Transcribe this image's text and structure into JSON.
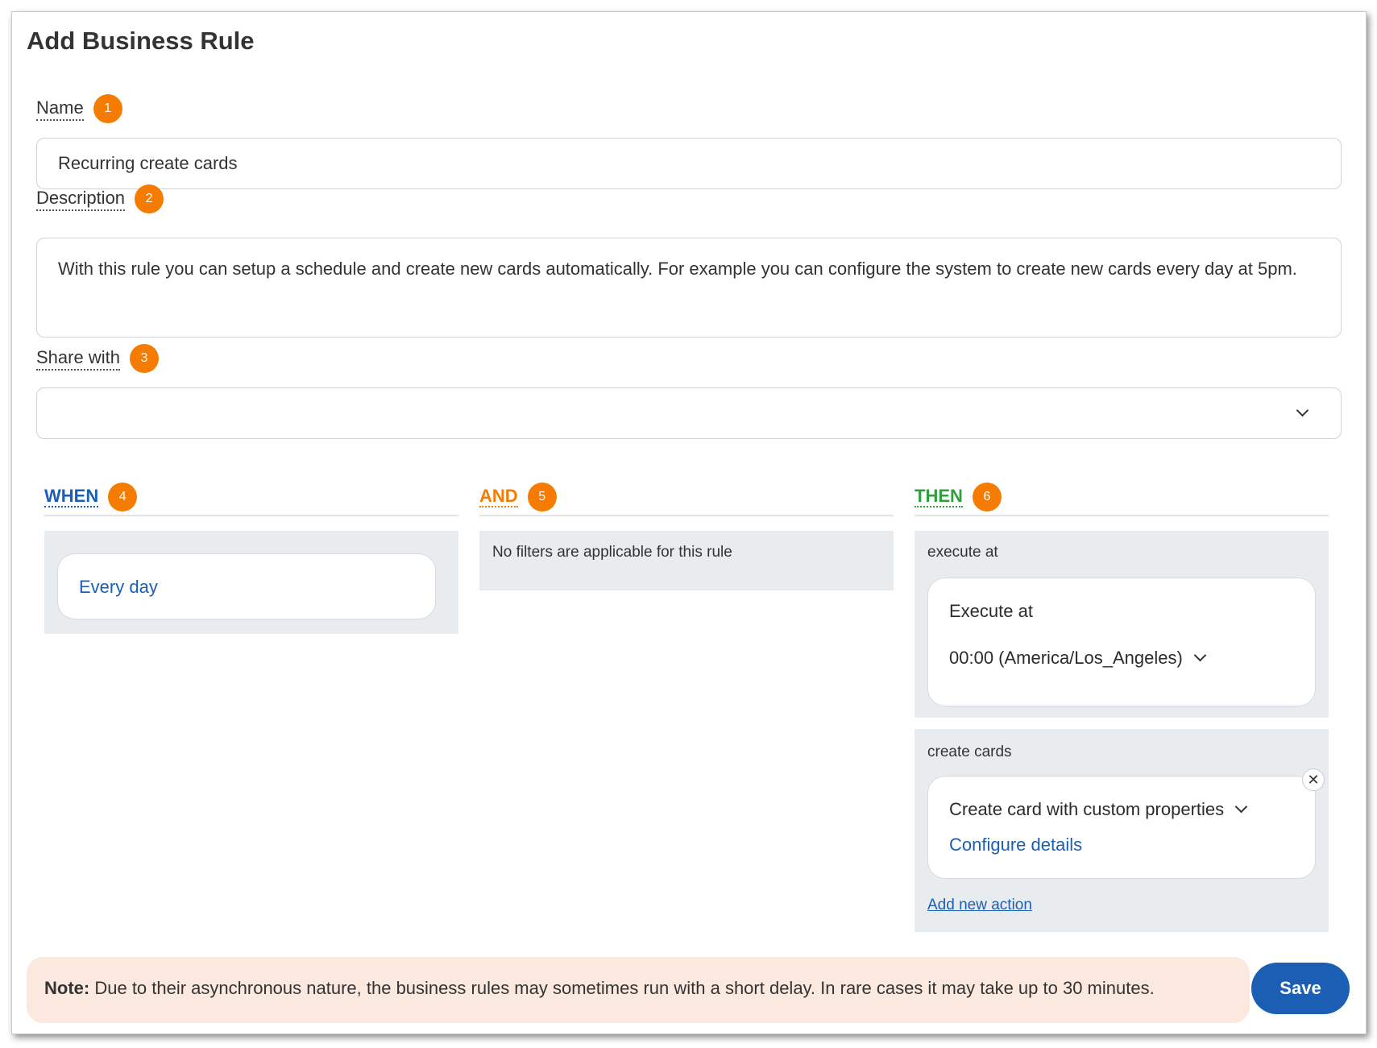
{
  "dialog": {
    "title": "Add Business Rule"
  },
  "fields": {
    "name": {
      "label": "Name",
      "badge": "1",
      "value": "Recurring create cards"
    },
    "description": {
      "label": "Description",
      "badge": "2",
      "value": "With this rule you can setup a schedule and create new cards automatically. For example you can configure the system to create new cards every day at 5pm."
    },
    "share": {
      "label": "Share with",
      "badge": "3",
      "value": ""
    }
  },
  "columns": {
    "when": {
      "title": "WHEN",
      "badge": "4",
      "trigger": "Every day"
    },
    "and": {
      "title": "AND",
      "badge": "5",
      "message": "No filters are applicable for this rule"
    },
    "then": {
      "title": "THEN",
      "badge": "6",
      "execute_section": "execute at",
      "execute_label": "Execute at",
      "execute_value": "00:00 (America/Los_Angeles)",
      "create_section": "create cards",
      "create_value": "Create card with custom properties",
      "configure_link": "Configure details",
      "add_action": "Add new action"
    }
  },
  "note": {
    "prefix": "Note:",
    "text": "Due to their asynchronous nature, the business rules may sometimes run with a short delay. In rare cases it may take up to 30 minutes."
  },
  "save_label": "Save",
  "colors": {
    "accent": "#1a5fb4",
    "badge": "#f57c00",
    "then": "#2e9e3e",
    "note_bg": "#fbe8df",
    "panel_bg": "#e9ecef"
  }
}
